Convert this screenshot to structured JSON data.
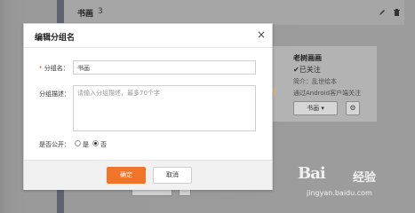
{
  "background": {
    "group_title": "书画",
    "group_count": "3",
    "card": {
      "name": "老树画画",
      "follow_status": "✔已关注",
      "intro": "简介：乱世绘本",
      "via": "通过Android客户端关注",
      "group_select": "书画 ▾",
      "gear": "⚙"
    }
  },
  "dialog": {
    "title": "编辑分组名",
    "close": "×",
    "name_label_req": "*",
    "name_label": "分组名：",
    "name_value": "书画",
    "desc_label": "分组描述：",
    "desc_placeholder": "请输入分组描述，最多70个字",
    "public_label": "是否公开：",
    "public_yes": "是",
    "public_no": "否",
    "public_selected": "否",
    "ok": "确定",
    "cancel": "取消"
  },
  "watermark": {
    "logo": "Bai",
    "cn": "经验",
    "url": "jingyan.baidu.com"
  },
  "colors": {
    "accent": "#f0752b",
    "overlay": "#9a9a9a",
    "sidebar": "#5e6370"
  }
}
